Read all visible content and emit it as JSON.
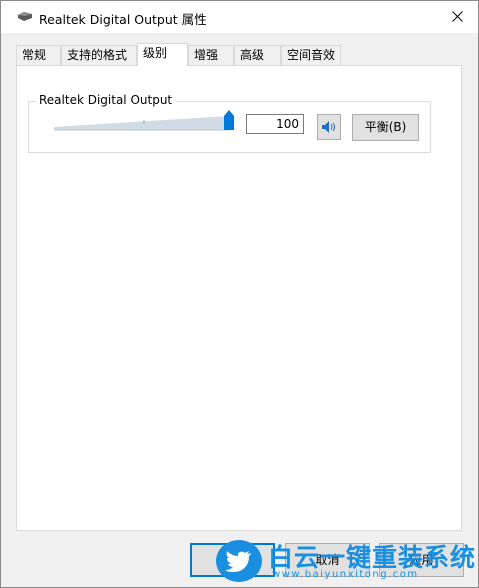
{
  "window": {
    "title": "Realtek Digital Output 属性"
  },
  "tabs": [
    {
      "label": "常规"
    },
    {
      "label": "支持的格式"
    },
    {
      "label": "级别"
    },
    {
      "label": "增强"
    },
    {
      "label": "高级"
    },
    {
      "label": "空间音效"
    }
  ],
  "active_tab": "级别",
  "levels": {
    "device_label": "Realtek Digital Output",
    "volume_value": "100",
    "volume_level": 1.0,
    "balance_label": "平衡(B)"
  },
  "buttons": {
    "ok": "确定",
    "cancel": "取消",
    "apply": "应用"
  },
  "watermark": {
    "brand": "白云一键重装系统",
    "url": "www.baiyunxitong.com"
  },
  "colors": {
    "accent": "#0078d7",
    "slider_thumb": "#0078d7",
    "watermark": "#1a8fe0"
  }
}
